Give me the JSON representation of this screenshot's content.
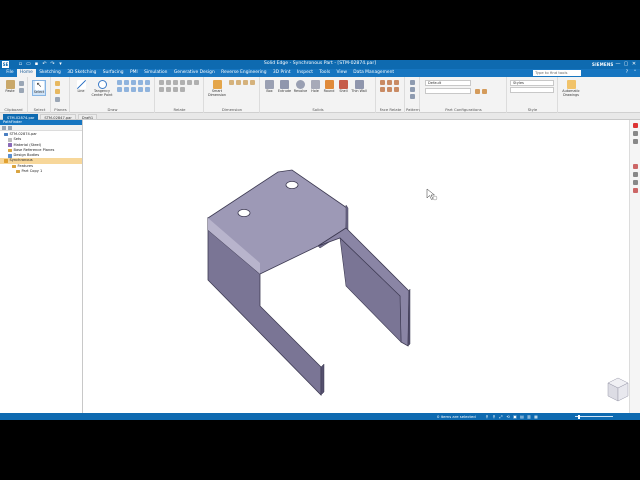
{
  "titlebar": {
    "logo": "SE",
    "title": "Solid Edge - Synchronous Part - [STM-02874.par]",
    "brand": "SIEMENS",
    "window_buttons": [
      "—",
      "▢",
      "✕"
    ]
  },
  "menu": {
    "tabs": [
      "File",
      "Home",
      "Sketching",
      "3D Sketching",
      "Surfacing",
      "PMI",
      "Simulation",
      "Generative Design",
      "Reverse Engineering",
      "3D Print",
      "Inspect",
      "Tools",
      "View",
      "Data Management"
    ],
    "active": "Home",
    "search_placeholder": "Type to find tools"
  },
  "ribbon": {
    "groups": [
      {
        "id": "clipboard",
        "label": "Clipboard",
        "buttons": [
          "Paste"
        ]
      },
      {
        "id": "select",
        "label": "Select",
        "buttons": [
          "Select"
        ]
      },
      {
        "id": "planes",
        "label": "Planes",
        "buttons": []
      },
      {
        "id": "draw",
        "label": "Draw",
        "buttons": [
          "Line",
          "Tangency Center Point"
        ]
      },
      {
        "id": "relate",
        "label": "Relate",
        "buttons": []
      },
      {
        "id": "dimension",
        "label": "Dimension",
        "buttons": [
          "Smart Dimension"
        ]
      },
      {
        "id": "solids",
        "label": "Solids",
        "buttons": [
          "Box",
          "Extrude",
          "Revolve",
          "Hole",
          "Round",
          "Shell",
          "Thin Wall"
        ]
      },
      {
        "id": "face-relate",
        "label": "Face Relate",
        "buttons": []
      },
      {
        "id": "pattern",
        "label": "Pattern",
        "buttons": []
      },
      {
        "id": "part-configurations",
        "label": "Part Configurations",
        "buttons": []
      },
      {
        "id": "style",
        "label": "Style",
        "buttons": []
      },
      {
        "id": "automatic-drawings",
        "label": "",
        "buttons": [
          "Automatic Drawings"
        ]
      }
    ],
    "combo_default": "Default",
    "style_label": "Styles"
  },
  "doc_tabs": [
    {
      "label": "STM-02874.par",
      "active": true
    },
    {
      "label": "STM-02847.par",
      "active": false
    },
    {
      "label": "Draft1",
      "active": false
    }
  ],
  "pathfinder": {
    "title": "PathFinder",
    "tree": [
      {
        "label": "STM-02874.par",
        "indent": 1,
        "color": "#4a7fc1",
        "selected": false
      },
      {
        "label": "Sets",
        "indent": 2,
        "color": "#bbbbbb",
        "selected": false
      },
      {
        "label": "Material (Steel)",
        "indent": 2,
        "color": "#8a6ab8",
        "selected": false
      },
      {
        "label": "Base Reference Planes",
        "indent": 2,
        "color": "#d9a441",
        "selected": false
      },
      {
        "label": "Design Bodies",
        "indent": 2,
        "color": "#5a8fd0",
        "selected": false
      },
      {
        "label": "Synchronous",
        "indent": 1,
        "color": "#e0a030",
        "selected": true
      },
      {
        "label": "Features",
        "indent": 3,
        "color": "#d9a441",
        "selected": false
      },
      {
        "label": "Part Copy 1",
        "indent": 4,
        "color": "#d9a441",
        "selected": false
      }
    ]
  },
  "status": {
    "message": "0 items are selected",
    "icons": [
      "⚲",
      "⚲",
      "⤢",
      "⟲",
      "▣",
      "▤",
      "▥",
      "▦"
    ]
  },
  "colors": {
    "accent": "#0e6ab0",
    "part_surface": "#8f8aa8",
    "part_edge": "#3d3a52"
  },
  "icons": {
    "cursor": "mouse-pointer-icon",
    "view_cube": "view-cube-icon"
  }
}
